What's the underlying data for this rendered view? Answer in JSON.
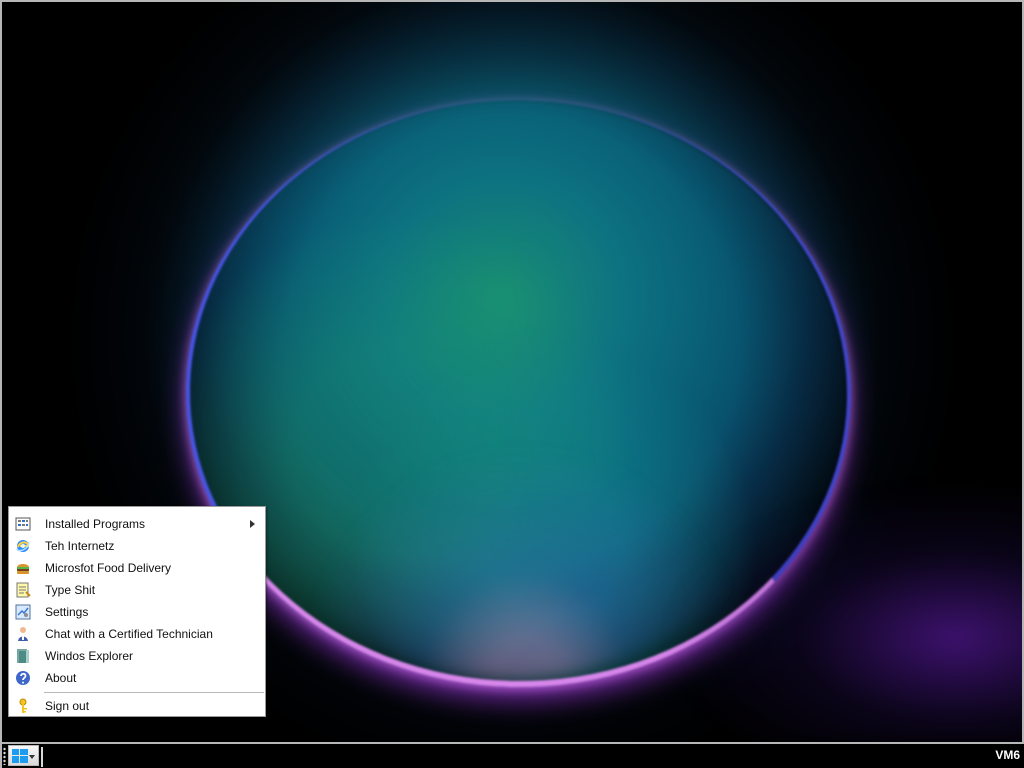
{
  "start_menu": {
    "items": [
      {
        "label": "Installed Programs",
        "icon": "programs-grid-icon",
        "has_submenu": true
      },
      {
        "label": "Teh Internetz",
        "icon": "internet-explorer-icon",
        "has_submenu": false
      },
      {
        "label": "Microsfot Food Delivery",
        "icon": "burger-icon",
        "has_submenu": false
      },
      {
        "label": "Type Shit",
        "icon": "notepad-icon",
        "has_submenu": false
      },
      {
        "label": "Settings",
        "icon": "settings-icon",
        "has_submenu": false
      },
      {
        "label": "Chat with a Certified Technician",
        "icon": "technician-icon",
        "has_submenu": false
      },
      {
        "label": "Windos Explorer",
        "icon": "explorer-icon",
        "has_submenu": false
      },
      {
        "label": "About",
        "icon": "help-icon",
        "has_submenu": false
      },
      {
        "label": "Sign out",
        "icon": "key-icon",
        "has_submenu": false
      }
    ]
  },
  "taskbar": {
    "start_icon": "windows-logo-icon",
    "system_label": "VM6"
  },
  "colors": {
    "desktop_border": "#b7b7b7",
    "taskbar_background": "#000000",
    "menu_background": "#ffffff"
  }
}
